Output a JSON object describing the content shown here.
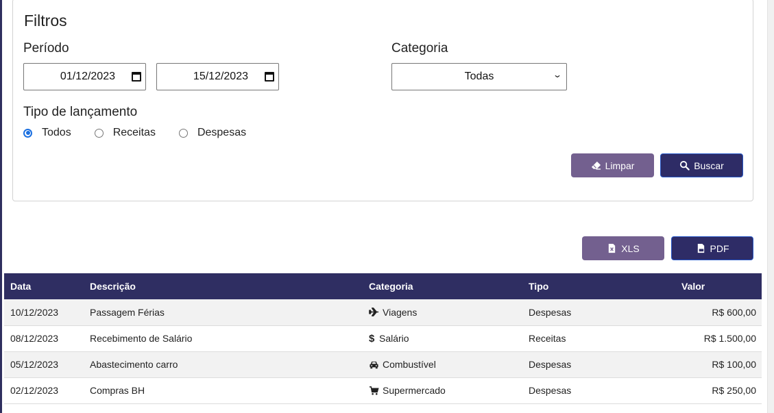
{
  "filters": {
    "title": "Filtros",
    "period_label": "Período",
    "date_from": "01/12/2023",
    "date_to": "15/12/2023",
    "category_label": "Categoria",
    "category_selected": "Todas",
    "type_label": "Tipo de lançamento",
    "type_options": [
      "Todos",
      "Receitas",
      "Despesas"
    ],
    "type_selected": "Todos",
    "clear_label": "Limpar",
    "search_label": "Buscar"
  },
  "export": {
    "xls_label": "XLS",
    "pdf_label": "PDF"
  },
  "table": {
    "headers": [
      "Data",
      "Descrição",
      "Categoria",
      "Tipo",
      "Valor"
    ],
    "rows": [
      {
        "date": "10/12/2023",
        "description": "Passagem Férias",
        "category": "Viagens",
        "category_icon": "plane-icon",
        "type": "Despesas",
        "value": "R$ 600,00",
        "kind": "negative"
      },
      {
        "date": "08/12/2023",
        "description": "Recebimento de Salário",
        "category": "Salário",
        "category_icon": "dollar-icon",
        "type": "Receitas",
        "value": "R$ 1.500,00",
        "kind": "positive"
      },
      {
        "date": "05/12/2023",
        "description": "Abastecimento carro",
        "category": "Combustível",
        "category_icon": "car-icon",
        "type": "Despesas",
        "value": "R$ 100,00",
        "kind": "negative"
      },
      {
        "date": "02/12/2023",
        "description": "Compras BH",
        "category": "Supermercado",
        "category_icon": "cart-icon",
        "type": "Despesas",
        "value": "R$ 250,00",
        "kind": "negative"
      }
    ]
  },
  "colors": {
    "header_bg": "#2f2e62",
    "button_purple": "#73608f",
    "button_navy": "#2e2c66",
    "negative": "#c0151e",
    "positive": "#20a44a"
  }
}
